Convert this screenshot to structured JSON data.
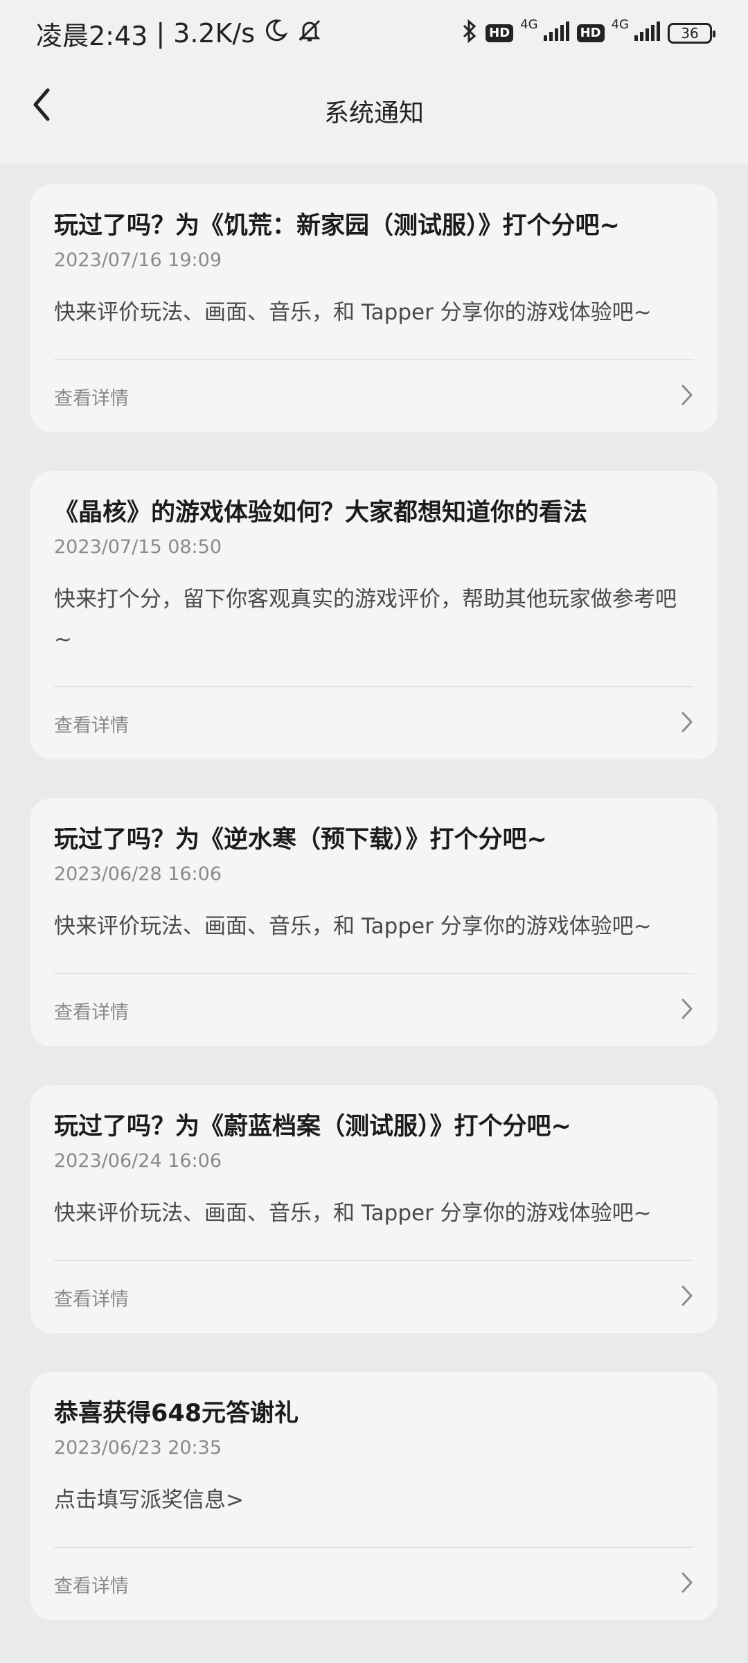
{
  "status_bar": {
    "time": "凌晨2:43",
    "separator": "|",
    "speed": "3.2K/s",
    "hd1": "HD",
    "net1": "4G",
    "hd2": "HD",
    "net2": "4G",
    "battery": "36"
  },
  "header": {
    "title": "系统通知"
  },
  "notifications": [
    {
      "title": "玩过了吗？为《饥荒：新家园（测试服）》打个分吧~",
      "time": "2023/07/16 19:09",
      "body": "快来评价玩法、画面、音乐，和 Tapper 分享你的游戏体验吧~",
      "link_label": "查看详情"
    },
    {
      "title": "《晶核》的游戏体验如何？大家都想知道你的看法",
      "time": "2023/07/15 08:50",
      "body": "快来打个分，留下你客观真实的游戏评价，帮助其他玩家做参考吧 ~",
      "link_label": "查看详情"
    },
    {
      "title": "玩过了吗？为《逆水寒（预下载）》打个分吧~",
      "time": "2023/06/28 16:06",
      "body": "快来评价玩法、画面、音乐，和 Tapper 分享你的游戏体验吧~",
      "link_label": "查看详情"
    },
    {
      "title": "玩过了吗？为《蔚蓝档案（测试服）》打个分吧~",
      "time": "2023/06/24 16:06",
      "body": "快来评价玩法、画面、音乐，和 Tapper 分享你的游戏体验吧~",
      "link_label": "查看详情"
    },
    {
      "title": "恭喜获得648元答谢礼",
      "time": "2023/06/23 20:35",
      "body": "点击填写派奖信息>",
      "link_label": "查看详情"
    }
  ]
}
